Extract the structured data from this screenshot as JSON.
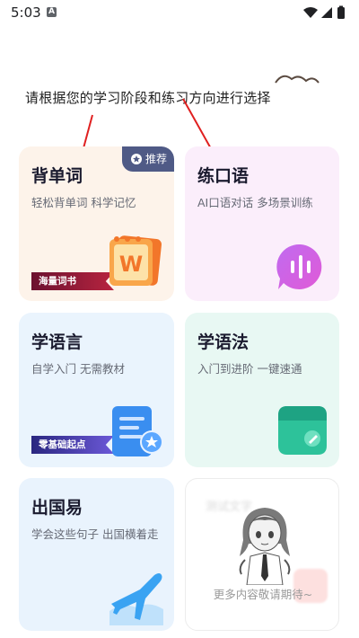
{
  "status_bar": {
    "time": "5:03",
    "notification_icon": "A"
  },
  "instruction": "请根据您的学习阶段和练习方向进行选择",
  "cards": {
    "vocab": {
      "title": "背单词",
      "subtitle": "轻松背单词 科学记忆",
      "badge": "推荐",
      "ribbon": "海量词书"
    },
    "speak": {
      "title": "练口语",
      "subtitle": "AI口语对话 多场景训练"
    },
    "lang": {
      "title": "学语言",
      "subtitle": "自学入门 无需教材",
      "ribbon": "零基础起点"
    },
    "gram": {
      "title": "学语法",
      "subtitle": "入门到进阶 一键速通"
    },
    "abroad": {
      "title": "出国易",
      "subtitle": "学会这些句子 出国横着走"
    },
    "soon": {
      "title": "测试文字",
      "text": "更多内容敬请期待~"
    }
  },
  "colors": {
    "arrow": "#e02020",
    "badge": "#4f5a86",
    "vocab_bg": "#fdf3ea",
    "speak_bg": "#fbeefb",
    "lang_bg": "#eaf4fd",
    "gram_bg": "#e8f8f3"
  }
}
